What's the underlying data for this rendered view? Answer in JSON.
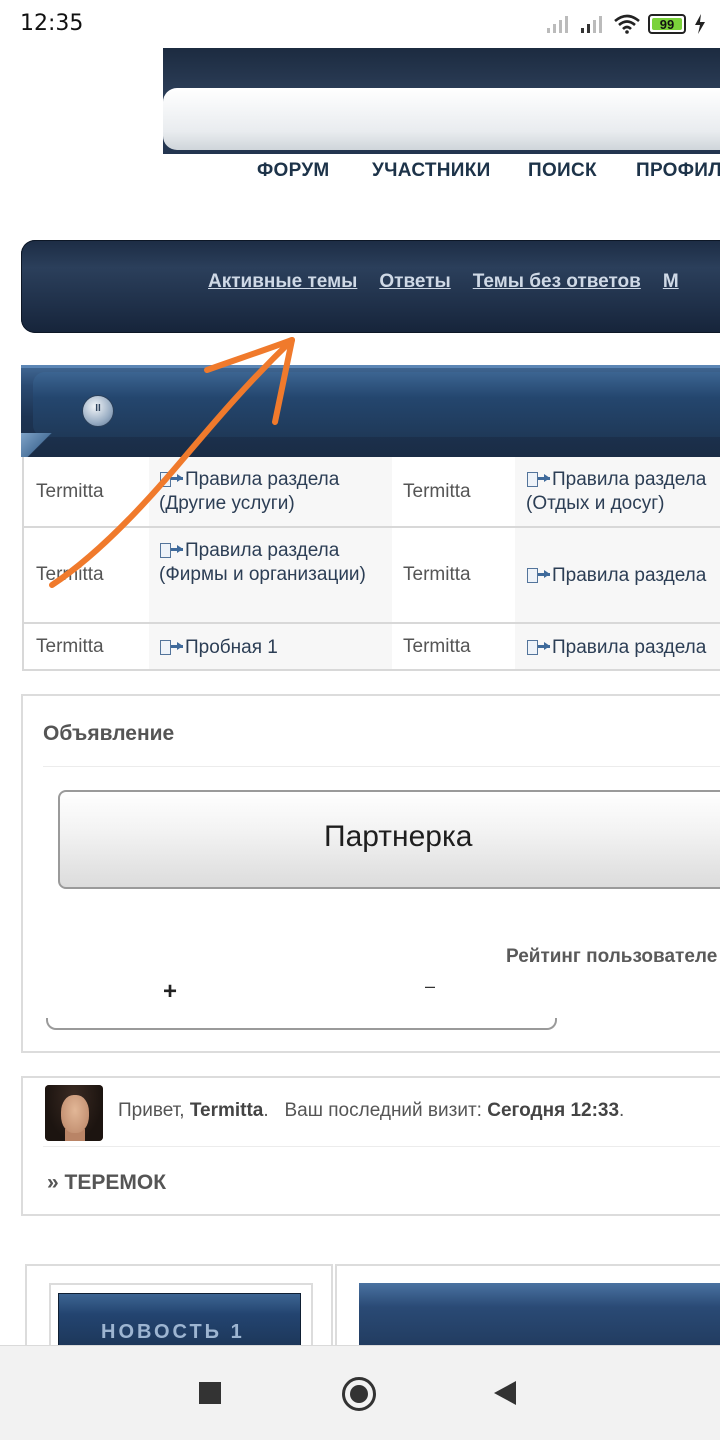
{
  "status_bar": {
    "time": "12:35",
    "battery": "99"
  },
  "main_nav": {
    "forum": "ФОРУМ",
    "members": "УЧАСТНИКИ",
    "search": "ПОИСК",
    "profile": "ПРОФИЛЬ"
  },
  "quick_links": [
    "Активные темы",
    "Ответы",
    "Темы без ответов",
    "М"
  ],
  "topics": [
    {
      "author1": "Termitta",
      "title1": "Правила раздела (Другие услуги)",
      "author2": "Termitta",
      "title2": "Правила раздела (Отдых и досуг)"
    },
    {
      "author1": "Termitta",
      "title1": "Правила раздела (Фирмы и организации)",
      "author2": "Termitta",
      "title2": "Правила раздела"
    },
    {
      "author1": "Termitta",
      "title1": "Пробная 1",
      "author2": "Termitta",
      "title2": "Правила раздела"
    }
  ],
  "announcement": {
    "heading": "Объявление",
    "button": "Партнерка",
    "rating_label": "Рейтинг пользователе",
    "plus": "+",
    "minus": "–"
  },
  "user": {
    "greeting": "Привет, ",
    "username": "Termitta",
    "last_visit_label": "Ваш последний визит: ",
    "last_visit_value": "Сегодня 12:33",
    "breadcrumb": "» ТЕРЕМОК"
  },
  "news": {
    "tab_label": "НОВОСТЬ 1"
  },
  "colors": {
    "annotation": "#f07a2c",
    "header_dark": "#1f3049",
    "link_dark": "#1d3349"
  }
}
